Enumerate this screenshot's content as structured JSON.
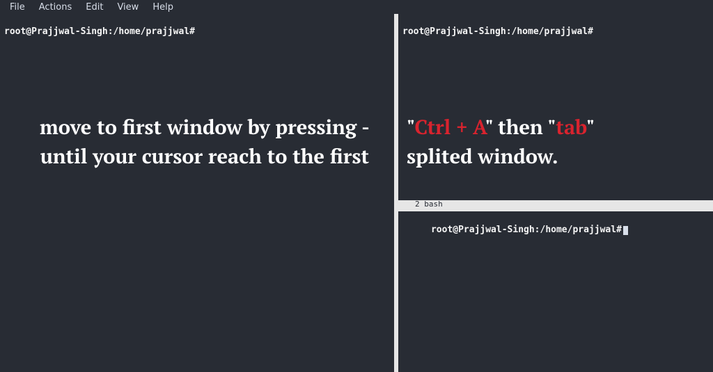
{
  "menubar": {
    "file": "File",
    "actions": "Actions",
    "edit": "Edit",
    "view": "View",
    "help": "Help"
  },
  "prompts": {
    "left": "root@Prajjwal-Singh:/home/prajjwal#",
    "right_top": "root@Prajjwal-Singh:/home/prajjwal#",
    "right_bottom": "root@Prajjwal-Singh:/home/prajjwal#"
  },
  "status": {
    "right_mid": "2 bash"
  },
  "overlay": {
    "left_line1": "move to first window by pressing -",
    "left_line2": "until your cursor reach to the first",
    "q1": "\"",
    "hl1": "Ctrl + A",
    "mid1": "\" then \"",
    "hl2": "tab",
    "q2": "\"",
    "right_line2": "splited window."
  }
}
